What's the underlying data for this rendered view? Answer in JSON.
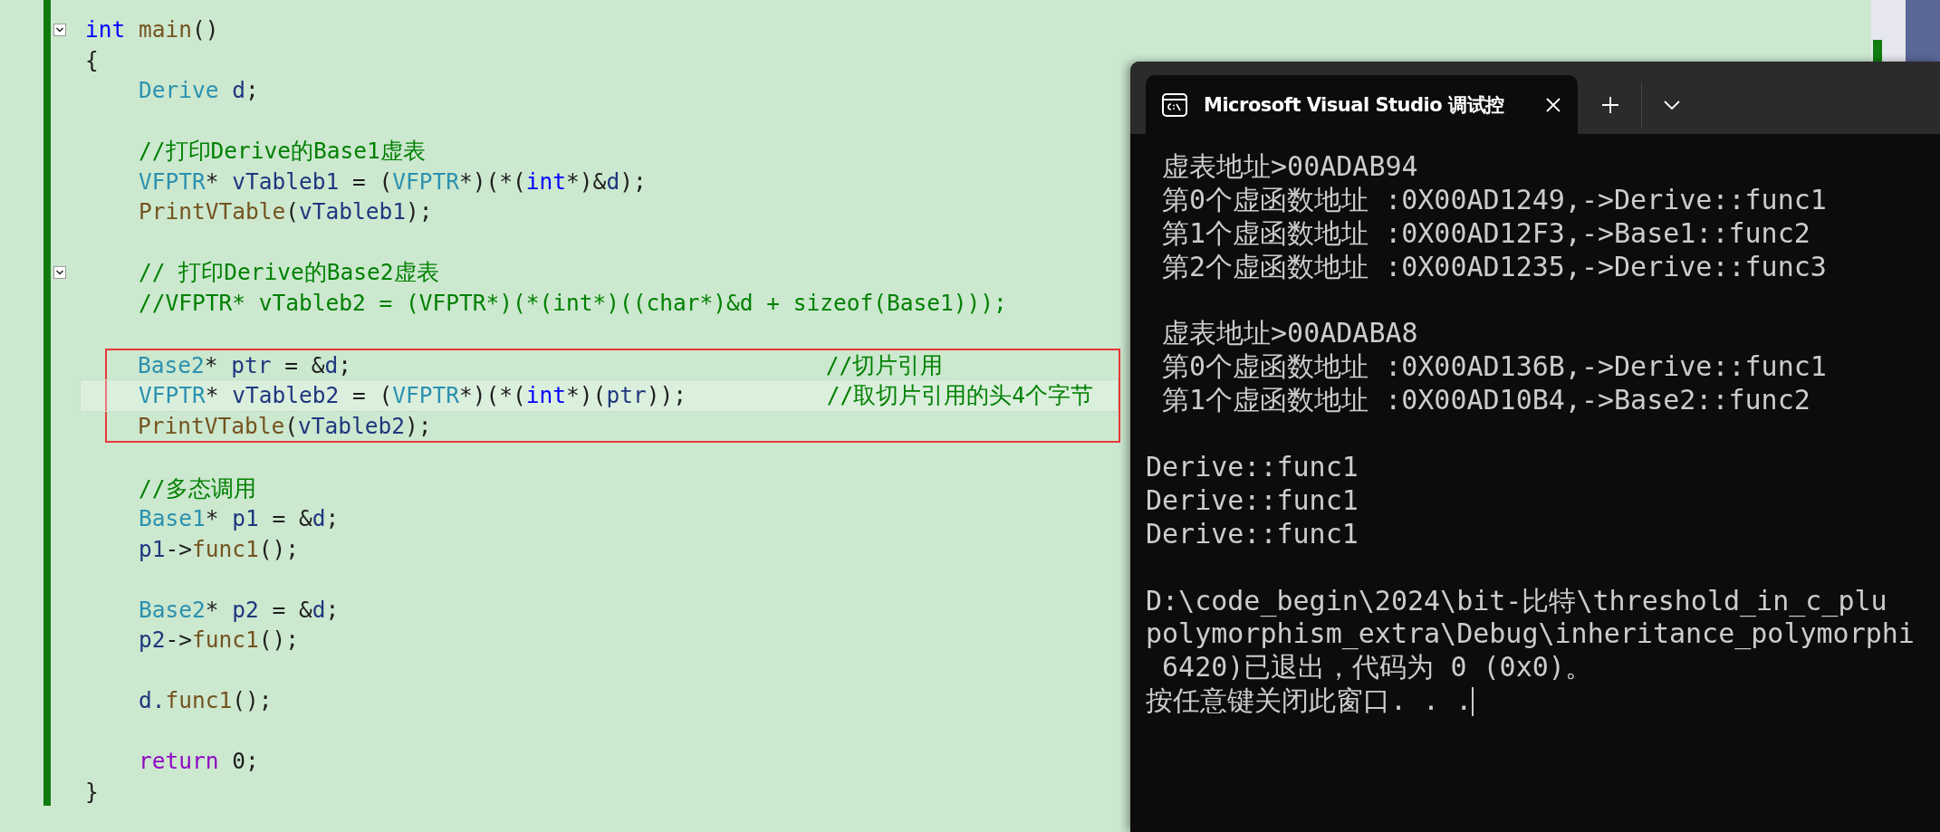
{
  "editor": {
    "lines": [
      {
        "kind": "code",
        "indented": false,
        "foldable": true,
        "current": false,
        "boxed": false,
        "tokens": [
          {
            "t": "int",
            "color": "#0000ff"
          },
          {
            "t": " main",
            "color": "#74531f"
          },
          {
            "t": "()",
            "color": "#1e1e1e"
          }
        ]
      },
      {
        "kind": "code",
        "indented": false,
        "foldable": false,
        "current": false,
        "boxed": false,
        "tokens": [
          {
            "t": "{",
            "color": "#1e1e1e"
          }
        ]
      },
      {
        "kind": "code",
        "indented": true,
        "foldable": false,
        "current": false,
        "boxed": false,
        "tokens": [
          {
            "t": "Derive",
            "color": "#2b91af"
          },
          {
            "t": " d",
            "color": "#1f377f"
          },
          {
            "t": ";",
            "color": "#1e1e1e"
          }
        ]
      },
      {
        "kind": "blank"
      },
      {
        "kind": "code",
        "indented": true,
        "foldable": false,
        "current": false,
        "boxed": false,
        "tokens": [
          {
            "t": "//打印Derive的Base1虚表",
            "color": "#008000"
          }
        ]
      },
      {
        "kind": "code",
        "indented": true,
        "foldable": false,
        "current": false,
        "boxed": false,
        "tokens": [
          {
            "t": "VFPTR",
            "color": "#2b91af"
          },
          {
            "t": "* ",
            "color": "#1e1e1e"
          },
          {
            "t": "vTableb1",
            "color": "#1f377f"
          },
          {
            "t": " = (",
            "color": "#1e1e1e"
          },
          {
            "t": "VFPTR",
            "color": "#2b91af"
          },
          {
            "t": "*)(*(",
            "color": "#1e1e1e"
          },
          {
            "t": "int",
            "color": "#0000ff"
          },
          {
            "t": "*)&",
            "color": "#1e1e1e"
          },
          {
            "t": "d",
            "color": "#1f377f"
          },
          {
            "t": ");",
            "color": "#1e1e1e"
          }
        ]
      },
      {
        "kind": "code",
        "indented": true,
        "foldable": false,
        "current": false,
        "boxed": false,
        "tokens": [
          {
            "t": "PrintVTable",
            "color": "#74531f"
          },
          {
            "t": "(",
            "color": "#1e1e1e"
          },
          {
            "t": "vTableb1",
            "color": "#1f377f"
          },
          {
            "t": ");",
            "color": "#1e1e1e"
          }
        ]
      },
      {
        "kind": "blank"
      },
      {
        "kind": "code",
        "indented": true,
        "foldable": true,
        "current": false,
        "boxed": false,
        "tokens": [
          {
            "t": "// 打印Derive的Base2虚表",
            "color": "#008000"
          }
        ]
      },
      {
        "kind": "code",
        "indented": true,
        "foldable": false,
        "current": false,
        "boxed": false,
        "tokens": [
          {
            "t": "//VFPTR* vTableb2 = (VFPTR*)(*(int*)((char*)&d + sizeof(Base1)));",
            "color": "#008000"
          }
        ]
      },
      {
        "kind": "blank"
      },
      {
        "kind": "code",
        "indented": true,
        "foldable": false,
        "current": false,
        "boxed": true,
        "tokens": [
          {
            "t": "Base2",
            "color": "#2b91af"
          },
          {
            "t": "* ",
            "color": "#1e1e1e"
          },
          {
            "t": "ptr",
            "color": "#1f377f"
          },
          {
            "t": " = &",
            "color": "#1e1e1e"
          },
          {
            "t": "d",
            "color": "#1f377f"
          },
          {
            "t": ";",
            "color": "#1e1e1e"
          }
        ],
        "trailing_comment": {
          "t": "//切片引用",
          "color": "#008000"
        }
      },
      {
        "kind": "code",
        "indented": true,
        "foldable": false,
        "current": true,
        "boxed": true,
        "tokens": [
          {
            "t": "VFPTR",
            "color": "#2b91af"
          },
          {
            "t": "* ",
            "color": "#1e1e1e"
          },
          {
            "t": "vTableb2",
            "color": "#1f377f"
          },
          {
            "t": " = (",
            "color": "#1e1e1e"
          },
          {
            "t": "VFPTR",
            "color": "#2b91af"
          },
          {
            "t": "*)(*(",
            "color": "#1e1e1e"
          },
          {
            "t": "int",
            "color": "#0000ff"
          },
          {
            "t": "*)(",
            "color": "#1e1e1e"
          },
          {
            "t": "ptr",
            "color": "#1f377f"
          },
          {
            "t": "));",
            "color": "#1e1e1e"
          }
        ],
        "trailing_comment": {
          "t": "//取切片引用的头4个字节",
          "color": "#008000"
        }
      },
      {
        "kind": "code",
        "indented": true,
        "foldable": false,
        "current": false,
        "boxed": true,
        "tokens": [
          {
            "t": "PrintVTable",
            "color": "#74531f"
          },
          {
            "t": "(",
            "color": "#1e1e1e"
          },
          {
            "t": "vTableb2",
            "color": "#1f377f"
          },
          {
            "t": ");",
            "color": "#1e1e1e"
          }
        ]
      },
      {
        "kind": "blank"
      },
      {
        "kind": "code",
        "indented": true,
        "foldable": false,
        "current": false,
        "boxed": false,
        "tokens": [
          {
            "t": "//多态调用",
            "color": "#008000"
          }
        ]
      },
      {
        "kind": "code",
        "indented": true,
        "foldable": false,
        "current": false,
        "boxed": false,
        "tokens": [
          {
            "t": "Base1",
            "color": "#2b91af"
          },
          {
            "t": "* ",
            "color": "#1e1e1e"
          },
          {
            "t": "p1",
            "color": "#1f377f"
          },
          {
            "t": " = &",
            "color": "#1e1e1e"
          },
          {
            "t": "d",
            "color": "#1f377f"
          },
          {
            "t": ";",
            "color": "#1e1e1e"
          }
        ]
      },
      {
        "kind": "code",
        "indented": true,
        "foldable": false,
        "current": false,
        "boxed": false,
        "tokens": [
          {
            "t": "p1",
            "color": "#1f377f"
          },
          {
            "t": "->",
            "color": "#1e1e1e"
          },
          {
            "t": "func1",
            "color": "#74531f"
          },
          {
            "t": "();",
            "color": "#1e1e1e"
          }
        ]
      },
      {
        "kind": "blank"
      },
      {
        "kind": "code",
        "indented": true,
        "foldable": false,
        "current": false,
        "boxed": false,
        "tokens": [
          {
            "t": "Base2",
            "color": "#2b91af"
          },
          {
            "t": "* ",
            "color": "#1e1e1e"
          },
          {
            "t": "p2",
            "color": "#1f377f"
          },
          {
            "t": " = &",
            "color": "#1e1e1e"
          },
          {
            "t": "d",
            "color": "#1f377f"
          },
          {
            "t": ";",
            "color": "#1e1e1e"
          }
        ]
      },
      {
        "kind": "code",
        "indented": true,
        "foldable": false,
        "current": false,
        "boxed": false,
        "tokens": [
          {
            "t": "p2",
            "color": "#1f377f"
          },
          {
            "t": "->",
            "color": "#1e1e1e"
          },
          {
            "t": "func1",
            "color": "#74531f"
          },
          {
            "t": "();",
            "color": "#1e1e1e"
          }
        ]
      },
      {
        "kind": "blank"
      },
      {
        "kind": "code",
        "indented": true,
        "foldable": false,
        "current": false,
        "boxed": false,
        "tokens": [
          {
            "t": "d.",
            "color": "#1f377f"
          },
          {
            "t": "func1",
            "color": "#74531f"
          },
          {
            "t": "();",
            "color": "#1e1e1e"
          }
        ]
      },
      {
        "kind": "blank"
      },
      {
        "kind": "code",
        "indented": true,
        "foldable": false,
        "current": false,
        "boxed": false,
        "tokens": [
          {
            "t": "return",
            "color": "#8f08c4"
          },
          {
            "t": " 0;",
            "color": "#1e1e1e"
          }
        ]
      },
      {
        "kind": "code",
        "indented": false,
        "foldable": false,
        "current": false,
        "boxed": false,
        "tokens": [
          {
            "t": "}",
            "color": "#1e1e1e"
          }
        ]
      }
    ]
  },
  "terminal": {
    "tab": {
      "title": "Microsoft Visual Studio 调试控",
      "selected": true
    },
    "output": [
      [
        " 虚表地址>00ADAB94",
        " 第0个虚函数地址 :0X00AD1249,->Derive::func1",
        " 第1个虚函数地址 :0X00AD12F3,->Base1::func2",
        " 第2个虚函数地址 :0X00AD1235,->Derive::func3"
      ],
      [
        " 虚表地址>00ADABA8",
        " 第0个虚函数地址 :0X00AD136B,->Derive::func1",
        " 第1个虚函数地址 :0X00AD10B4,->Base2::func2"
      ],
      [
        "Derive::func1",
        "Derive::func1",
        "Derive::func1"
      ],
      [
        "D:\\code_begin\\2024\\bit-比特\\threshold_in_c_plu",
        "polymorphism_extra\\Debug\\inheritance_polymorphi",
        " 6420)已退出，代码为 0 (0x0)。",
        "按任意键关闭此窗口. . ."
      ]
    ]
  }
}
